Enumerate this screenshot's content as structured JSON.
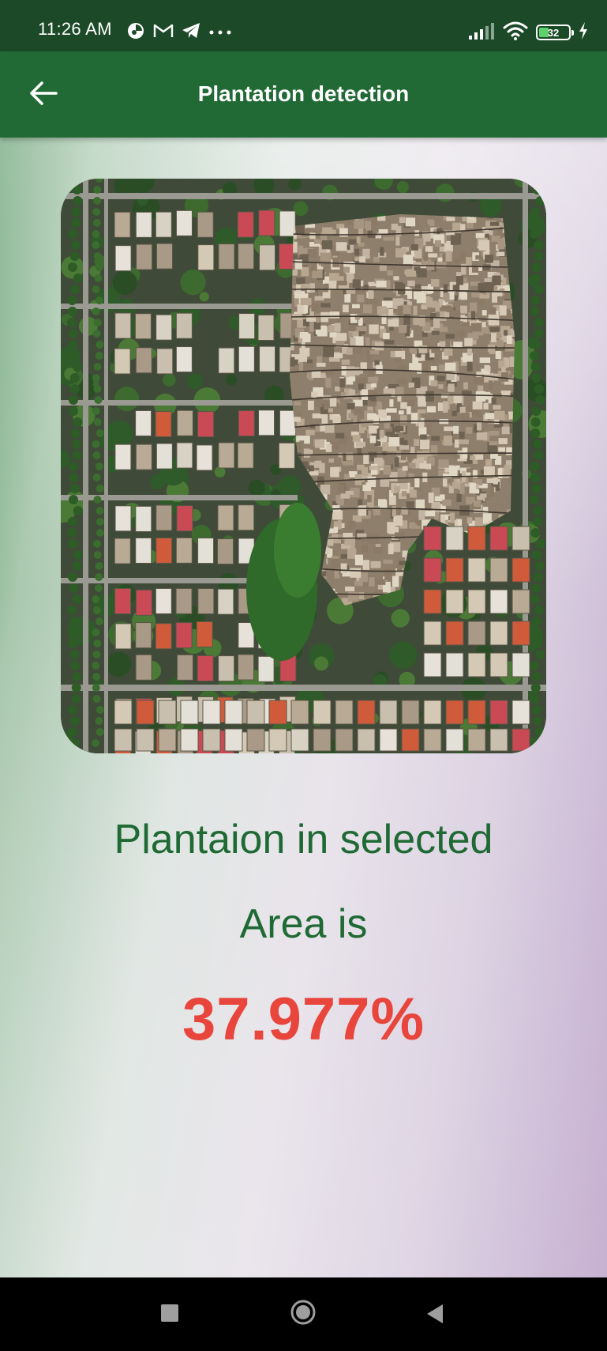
{
  "status_bar": {
    "time": "11:26 AM",
    "left_icons": [
      "notification-app-icon",
      "gmail-icon",
      "telegram-icon",
      "more-dots-icon"
    ],
    "right_icons": [
      "signal-icon",
      "wifi-icon",
      "battery-icon",
      "charging-icon"
    ],
    "battery_level": "32",
    "battery_fraction": 0.32,
    "battery_color": "#5fd16a"
  },
  "app_bar": {
    "title": "Plantation detection",
    "back_icon": "arrow-back-icon",
    "color": "#216a35"
  },
  "main": {
    "image_icon": "aerial-city-photo",
    "result_line_1": "Plantaion in selected",
    "result_line_2": "Area is",
    "result_value": "37.977%",
    "text_color": "#1f6a34",
    "value_color": "#e8453c"
  },
  "nav_bar": {
    "icons": [
      "recent-apps-icon",
      "home-icon",
      "back-icon"
    ]
  }
}
